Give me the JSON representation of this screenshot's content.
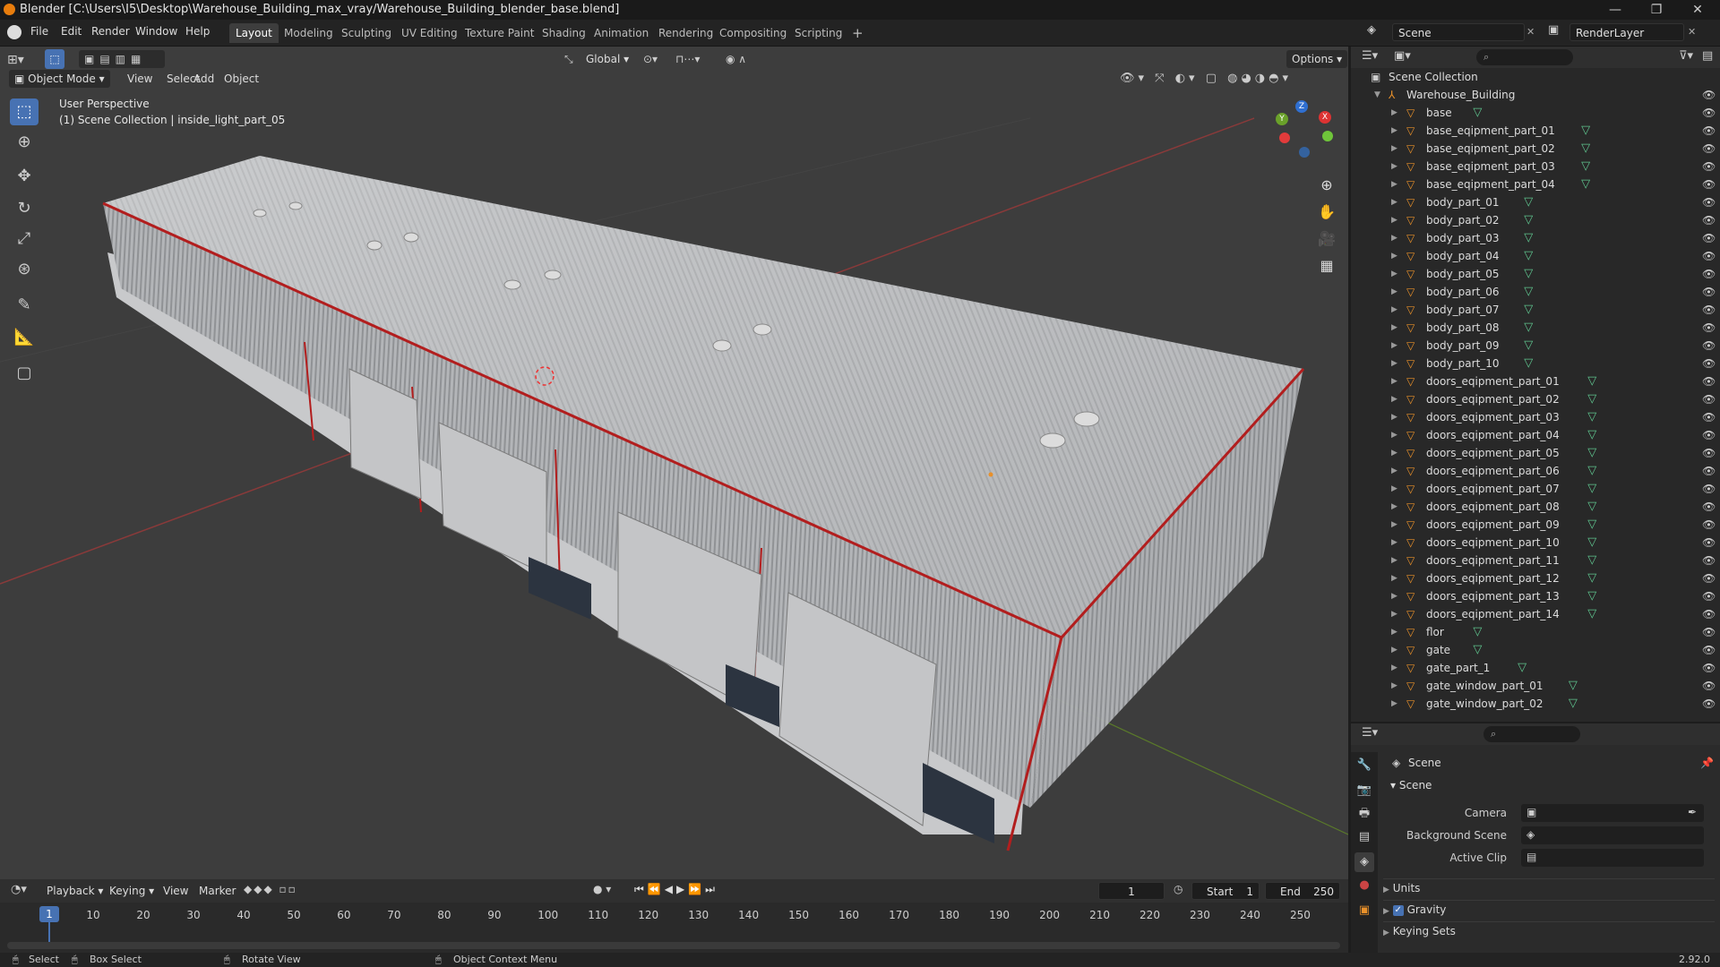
{
  "window": {
    "title": "Blender [C:\\Users\\I5\\Desktop\\Warehouse_Building_max_vray/Warehouse_Building_blender_base.blend]",
    "min": "—",
    "max": "❐",
    "close": "✕"
  },
  "menu": [
    "File",
    "Edit",
    "Render",
    "Window",
    "Help"
  ],
  "workspaces": [
    "Layout",
    "Modeling",
    "Sculpting",
    "UV Editing",
    "Texture Paint",
    "Shading",
    "Animation",
    "Rendering",
    "Compositing",
    "Scripting"
  ],
  "active_workspace": "Layout",
  "add_workspace": "+",
  "scene_field": "Scene",
  "renderlayer_field": "RenderLayer",
  "viewport": {
    "transform_orientation": "Global",
    "options_label": "Options",
    "mode": "Object Mode",
    "header_menus": [
      "View",
      "Select",
      "Add",
      "Object"
    ],
    "overlay_line1": "User Perspective",
    "overlay_line2": "(1) Scene Collection | inside_light_part_05",
    "gizmo": {
      "x": "X",
      "y": "Y",
      "z": "Z"
    }
  },
  "outliner": {
    "root": "Scene Collection",
    "collection": "Warehouse_Building",
    "items": [
      "base",
      "base_eqipment_part_01",
      "base_eqipment_part_02",
      "base_eqipment_part_03",
      "base_eqipment_part_04",
      "body_part_01",
      "body_part_02",
      "body_part_03",
      "body_part_04",
      "body_part_05",
      "body_part_06",
      "body_part_07",
      "body_part_08",
      "body_part_09",
      "body_part_10",
      "doors_eqipment_part_01",
      "doors_eqipment_part_02",
      "doors_eqipment_part_03",
      "doors_eqipment_part_04",
      "doors_eqipment_part_05",
      "doors_eqipment_part_06",
      "doors_eqipment_part_07",
      "doors_eqipment_part_08",
      "doors_eqipment_part_09",
      "doors_eqipment_part_10",
      "doors_eqipment_part_11",
      "doors_eqipment_part_12",
      "doors_eqipment_part_13",
      "doors_eqipment_part_14",
      "flor",
      "gate",
      "gate_part_1",
      "gate_window_part_01",
      "gate_window_part_02"
    ]
  },
  "properties": {
    "context": "Scene",
    "panel": "Scene",
    "camera_label": "Camera",
    "background_label": "Background Scene",
    "clip_label": "Active Clip",
    "sections": [
      "Units",
      "Gravity",
      "Keying Sets"
    ],
    "gravity_checked": true
  },
  "timeline": {
    "menus": [
      "Playback",
      "Keying",
      "View",
      "Marker"
    ],
    "current_frame": "1",
    "start_label": "Start",
    "start_value": "1",
    "end_label": "End",
    "end_value": "250",
    "ticks": [
      "1",
      "10",
      "20",
      "30",
      "40",
      "50",
      "60",
      "70",
      "80",
      "90",
      "100",
      "110",
      "120",
      "130",
      "140",
      "150",
      "160",
      "170",
      "180",
      "190",
      "200",
      "210",
      "220",
      "230",
      "240",
      "250"
    ]
  },
  "status": {
    "select": "Select",
    "box_select": "Box Select",
    "rotate_view": "Rotate View",
    "context_menu": "Object Context Menu",
    "version": "2.92.0"
  },
  "colors": {
    "accent": "#4772b3",
    "object_icon": "#e8902a",
    "mesh_icon": "#5fc48e",
    "playhead": "#4772b3"
  }
}
